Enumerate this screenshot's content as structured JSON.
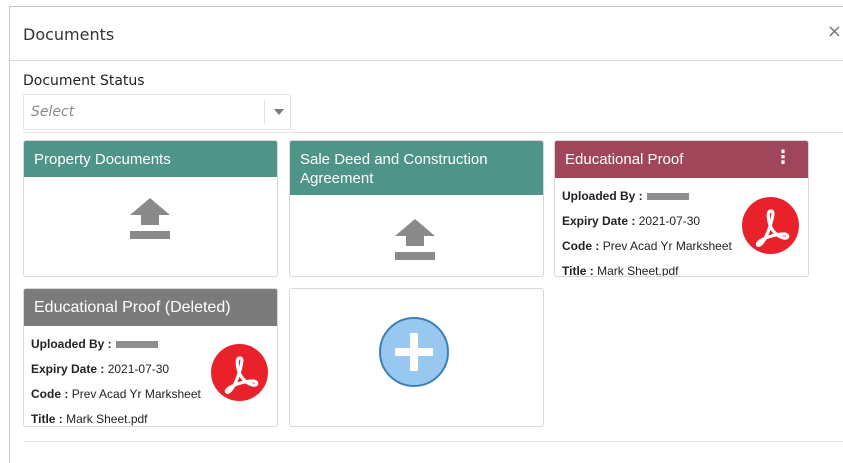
{
  "dialog": {
    "title": "Documents",
    "close_symbol": "×"
  },
  "filter": {
    "label": "Document Status",
    "placeholder": "Select"
  },
  "cards": [
    {
      "header": "Property Documents",
      "header_color": "#4e9489",
      "icon": "upload-icon"
    },
    {
      "header": "Sale Deed and Construction Agreement",
      "header_color": "#4e9489",
      "icon": "upload-icon"
    },
    {
      "header": "Educational Proof",
      "header_color": "#a0465a",
      "menu_symbol": "⋮",
      "uploaded_by_label": "Uploaded By :",
      "expiry_label": "Expiry Date :",
      "expiry_value": "2021-07-30",
      "code_label": "Code :",
      "code_value": "Prev Acad Yr Marksheet",
      "title_label": "Title :",
      "title_value": "Mark Sheet.pdf",
      "icon": "pdf-icon"
    },
    {
      "header": "Educational Proof (Deleted)",
      "header_color": "#7b7b7b",
      "uploaded_by_label": "Uploaded By :",
      "expiry_label": "Expiry Date :",
      "expiry_value": "2021-07-30",
      "code_label": "Code :",
      "code_value": "Prev Acad Yr Marksheet",
      "title_label": "Title :",
      "title_value": "Mark Sheet.pdf",
      "icon": "pdf-icon"
    },
    {
      "icon": "add-icon",
      "accent": "#98c8f0"
    }
  ]
}
